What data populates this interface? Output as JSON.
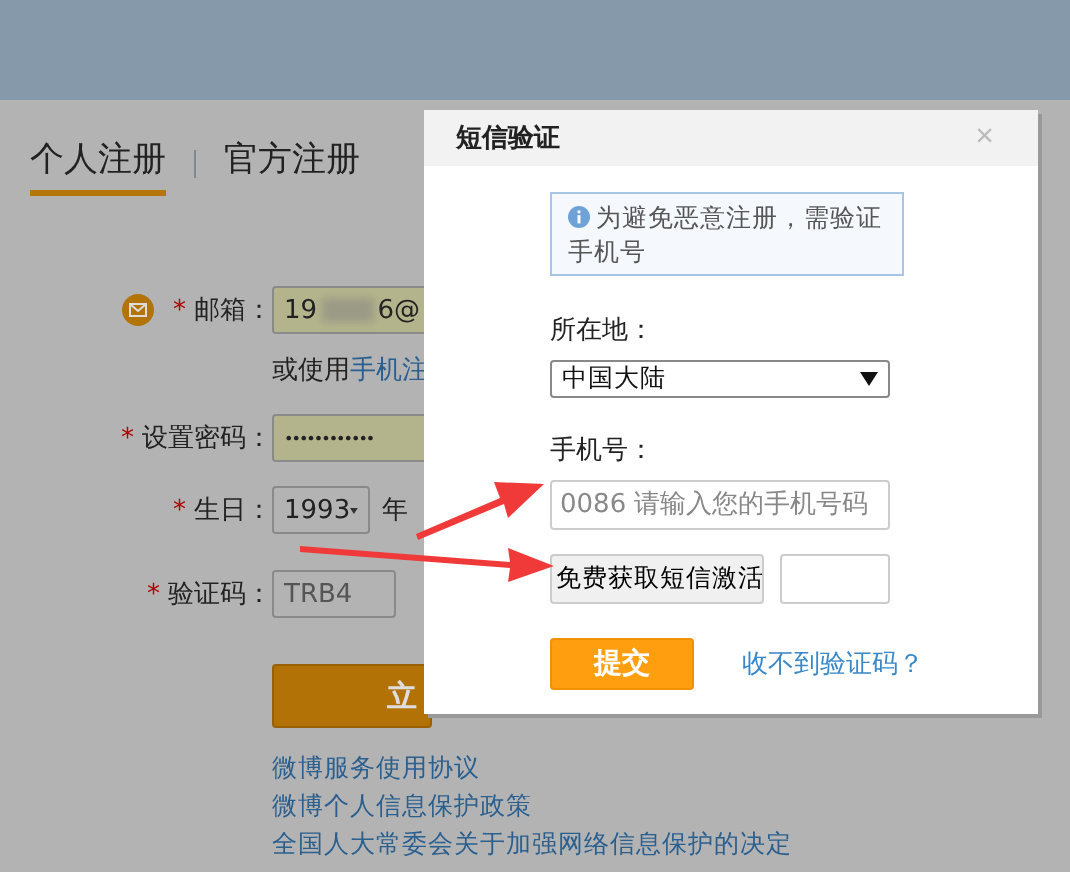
{
  "page": {
    "tabs": [
      {
        "label": "个人注册",
        "selected": true
      },
      {
        "label": "官方注册",
        "selected": false
      }
    ],
    "form": {
      "required_marks": [
        "*",
        "*",
        "*",
        "*"
      ],
      "email_label": "邮箱：",
      "email_value_start": "19",
      "email_value_end": "6@",
      "alt_text": "或使用",
      "alt_link": "手机注",
      "password_label": "设置密码：",
      "password_value": "••••••••••••",
      "birthday_label": "生日：",
      "birth_year": "1993",
      "year_unit": "年",
      "captcha_label": "验证码：",
      "captcha_value": "TRB4",
      "submit_label": "立"
    },
    "links": [
      "微博服务使用协议",
      "微博个人信息保护政策",
      "全国人大常委会关于加强网络信息保护的决定"
    ]
  },
  "dialog": {
    "title": "短信验证",
    "close": "×",
    "notice": "为避免恶意注册，需验证手机号",
    "region_label": "所在地：",
    "region_value": "中国大陆",
    "phone_label": "手机号：",
    "phone_placeholder": "0086 请输入您的手机号码",
    "sms_button": "免费获取短信激活",
    "submit": "提交",
    "help_link": "收不到验证码？"
  }
}
